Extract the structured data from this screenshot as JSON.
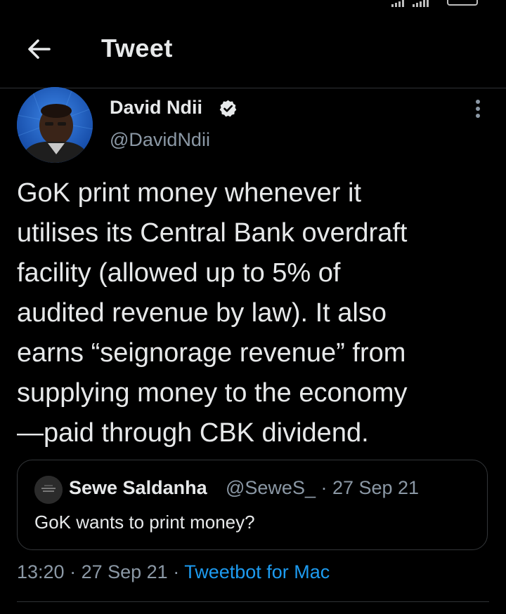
{
  "header": {
    "title": "Tweet"
  },
  "tweet": {
    "author_name": "David Ndii",
    "author_handle": "@DavidNdii",
    "text": "GoK print money whenever it\nutilises its  Central Bank overdraft\nfacility (allowed up to 5% of\naudited revenue by law). It also\nearns “seignorage revenue” from\nsupplying money to the economy\n—paid through CBK dividend.",
    "time": "13:20",
    "separator_1": " · ",
    "date": "27 Sep 21",
    "separator_2": " · ",
    "source": "Tweetbot for Mac"
  },
  "quote": {
    "author_name": "Sewe Saldanha",
    "meta": "@SeweS_ · 27 Sep 21",
    "text": "GoK wants to print money?"
  },
  "icons": {
    "back": "arrow-left-icon",
    "verified": "verified-badge-icon",
    "more": "vertical-ellipsis-icon"
  },
  "colors": {
    "background": "#000000",
    "text": "#e7e9ea",
    "secondary": "#8b98a5",
    "accent": "#1d9bf0",
    "border": "#2f3336"
  }
}
